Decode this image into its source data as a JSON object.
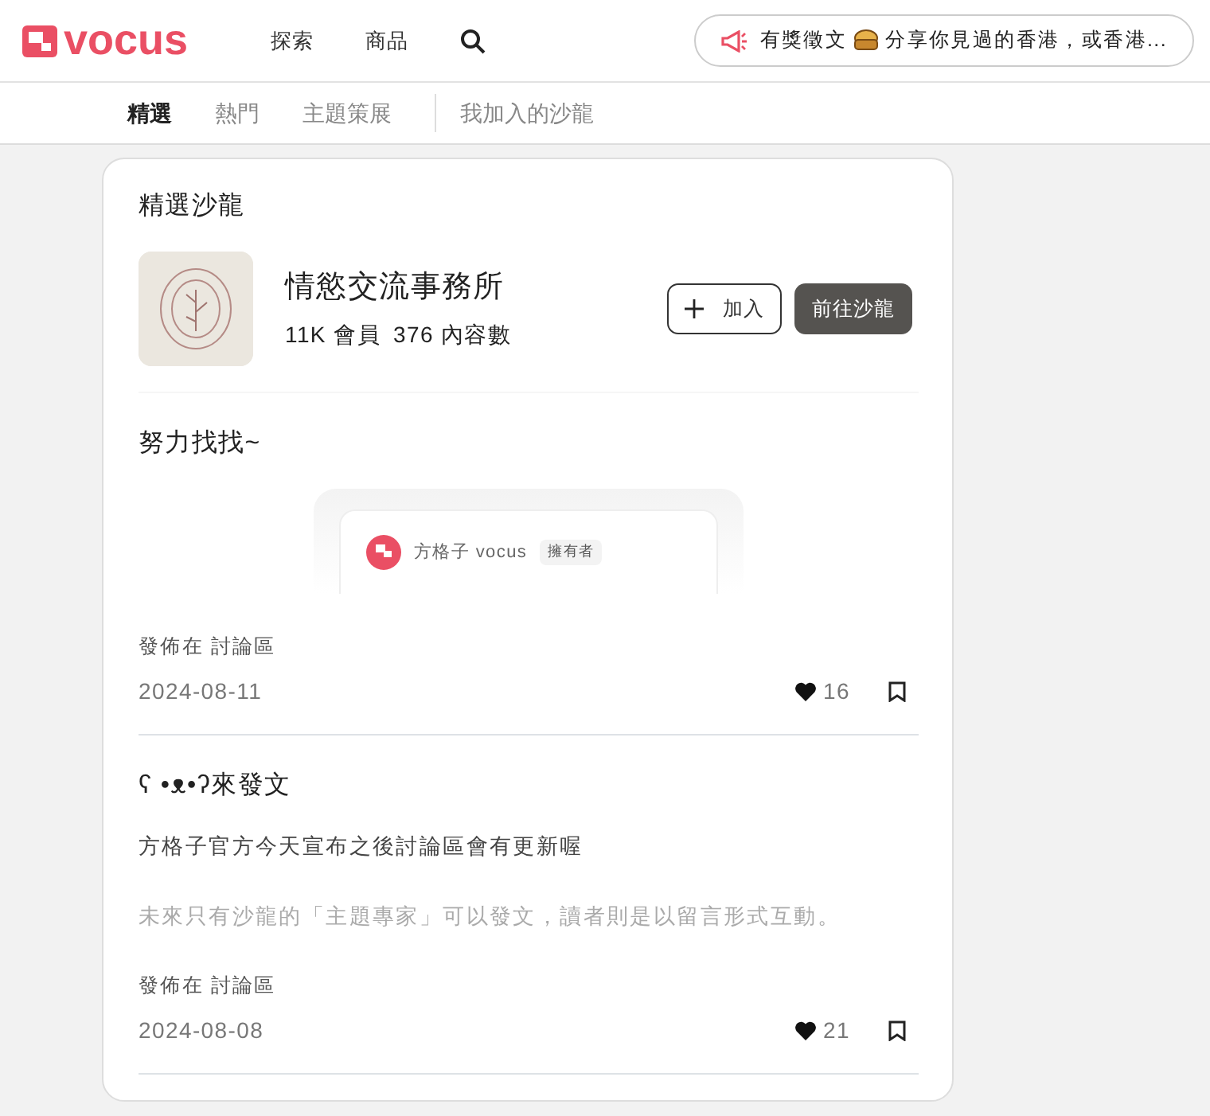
{
  "header": {
    "logo_text": "vocus",
    "nav": [
      "探索",
      "商品"
    ],
    "announcement": {
      "label": "有獎徵文",
      "text": "分享你見過的香港，或香港..."
    }
  },
  "tabs": [
    {
      "label": "精選",
      "selected": true
    },
    {
      "label": "熱門",
      "selected": false
    },
    {
      "label": "主題策展",
      "selected": false
    }
  ],
  "secondary_tabs": [
    {
      "label": "我加入的沙龍",
      "selected": false
    }
  ],
  "featured": {
    "title": "精選沙龍",
    "salon": {
      "name": "情慾交流事務所",
      "members": "11K",
      "members_label": "會員",
      "contents": "376",
      "contents_label": "內容數"
    },
    "join_button": "加入",
    "go_button": "前往沙龍"
  },
  "posts": [
    {
      "title": "努力找找~",
      "preview": {
        "author": "方格子 vocus",
        "badge": "擁有者"
      },
      "posted_label": "發佈在",
      "posted_in": "討論區",
      "date": "2024-08-11",
      "likes": "16"
    },
    {
      "title": "ʕ •ᴥ•ʔ來發文",
      "paragraphs": [
        {
          "text": "方格子官方今天宣布之後討論區會有更新喔",
          "muted": false
        },
        {
          "text": "未來只有沙龍的「主題專家」可以發文，讀者則是以留言形式互動。",
          "muted": true
        }
      ],
      "posted_label": "發佈在",
      "posted_in": "討論區",
      "date": "2024-08-08",
      "likes": "21"
    }
  ]
}
